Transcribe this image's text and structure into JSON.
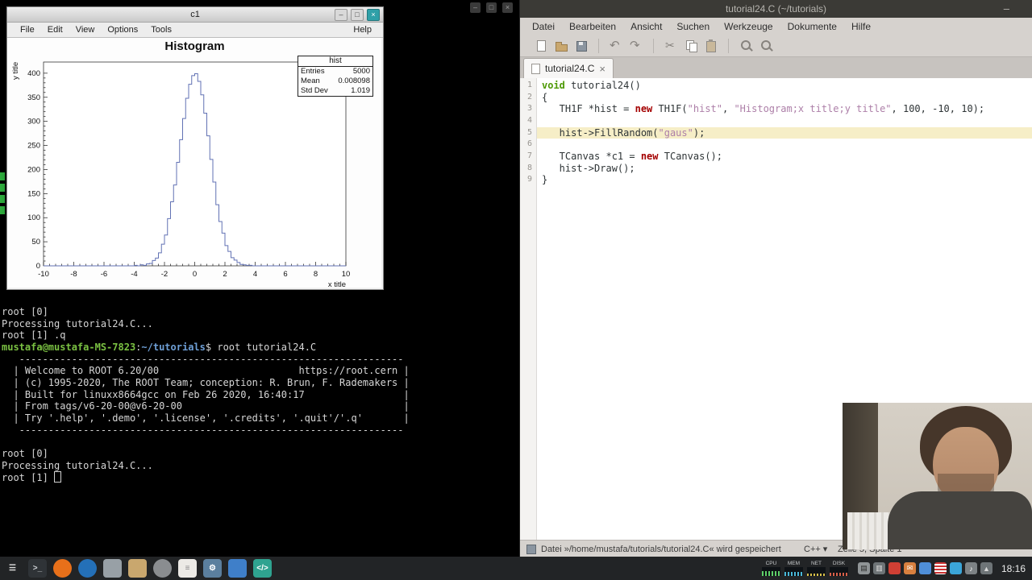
{
  "window_controls": {
    "minimize": "–",
    "maximize": "□",
    "close": "×"
  },
  "root_window": {
    "title": "c1",
    "menus": [
      "File",
      "Edit",
      "View",
      "Options",
      "Tools"
    ],
    "help_menu": "Help"
  },
  "chart_data": {
    "type": "bar",
    "style": "step-histogram",
    "title": "Histogram",
    "xlabel": "x title",
    "ylabel": "y title",
    "xlim": [
      -10,
      10
    ],
    "ylim": [
      0,
      400
    ],
    "x_ticks": [
      -10,
      -8,
      -6,
      -4,
      -2,
      0,
      2,
      4,
      6,
      8,
      10
    ],
    "y_ticks": [
      0,
      50,
      100,
      150,
      200,
      250,
      300,
      350,
      400
    ],
    "n_bins": 100,
    "bin_width": 0.2,
    "line_color": "#6272b4",
    "grid": false,
    "legend": false,
    "bin_centers": [
      -3.9,
      -3.7,
      -3.5,
      -3.3,
      -3.1,
      -2.9,
      -2.7,
      -2.5,
      -2.3,
      -2.1,
      -1.9,
      -1.7,
      -1.5,
      -1.3,
      -1.1,
      -0.9,
      -0.7,
      -0.5,
      -0.3,
      -0.1,
      0.1,
      0.3,
      0.5,
      0.7,
      0.9,
      1.1,
      1.3,
      1.5,
      1.7,
      1.9,
      2.1,
      2.3,
      2.5,
      2.7,
      2.9,
      3.1,
      3.3,
      3.5,
      3.7,
      3.9
    ],
    "counts": [
      1,
      0,
      2,
      1,
      4,
      5,
      11,
      16,
      27,
      45,
      64,
      98,
      133,
      168,
      215,
      262,
      306,
      348,
      377,
      395,
      399,
      383,
      355,
      317,
      270,
      221,
      174,
      127,
      92,
      68,
      42,
      30,
      17,
      12,
      7,
      3,
      2,
      1,
      1,
      0
    ],
    "stats": {
      "title": "hist",
      "rows": [
        [
          "Entries",
          "5000"
        ],
        [
          "Mean",
          "0.008098"
        ],
        [
          "Std Dev",
          "1.019"
        ]
      ]
    }
  },
  "terminal": {
    "lines": [
      [
        [
          "root [0]",
          "plain"
        ]
      ],
      [
        [
          "Processing tutorial24.C...",
          "plain"
        ]
      ],
      [
        [
          "root [1] .q",
          "plain"
        ]
      ],
      [
        [
          "mustafa@mustafa-MS-7823",
          "user"
        ],
        [
          ":",
          "plain"
        ],
        [
          "~/tutorials",
          "path"
        ],
        [
          "$ root tutorial24.C",
          "plain"
        ]
      ],
      [
        [
          "   ------------------------------------------------------------------",
          "plain"
        ]
      ],
      [
        [
          "  | Welcome to ROOT 6.20/00                        https://root.cern |",
          "plain"
        ]
      ],
      [
        [
          "  | (c) 1995-2020, The ROOT Team; conception: R. Brun, F. Rademakers |",
          "plain"
        ]
      ],
      [
        [
          "  | Built for linuxx8664gcc on Feb 26 2020, 16:40:17                 |",
          "plain"
        ]
      ],
      [
        [
          "  | From tags/v6-20-00@v6-20-00                                      |",
          "plain"
        ]
      ],
      [
        [
          "  | Try '.help', '.demo', '.license', '.credits', '.quit'/'.q'       |",
          "plain"
        ]
      ],
      [
        [
          "   ------------------------------------------------------------------",
          "plain"
        ]
      ],
      [
        [
          "",
          "plain"
        ]
      ],
      [
        [
          "root [0]",
          "plain"
        ]
      ],
      [
        [
          "Processing tutorial24.C...",
          "plain"
        ]
      ],
      [
        [
          "root [1] ",
          "plain"
        ],
        [
          "",
          "cursor"
        ]
      ]
    ]
  },
  "editor": {
    "titlebar_title": "tutorial24.C (~/tutorials)",
    "menus": [
      "Datei",
      "Bearbeiten",
      "Ansicht",
      "Suchen",
      "Werkzeuge",
      "Dokumente",
      "Hilfe"
    ],
    "toolbar": [
      "new",
      "open",
      "save",
      "|",
      "undo",
      "redo",
      "|",
      "cut",
      "copy",
      "paste",
      "|",
      "find",
      "replace"
    ],
    "tab": {
      "label": "tutorial24.C",
      "close": "×"
    },
    "code_lines": [
      {
        "n": "1",
        "current": false,
        "tokens": [
          [
            "void",
            "type"
          ],
          [
            " tutorial24()",
            "plain"
          ]
        ]
      },
      {
        "n": "2",
        "current": false,
        "tokens": [
          [
            "{",
            "plain"
          ]
        ]
      },
      {
        "n": "3",
        "current": false,
        "tokens": [
          [
            "   TH1F *hist = ",
            "plain"
          ],
          [
            "new",
            "kw"
          ],
          [
            " TH1F(",
            "plain"
          ],
          [
            "\"hist\"",
            "str"
          ],
          [
            ", ",
            "plain"
          ],
          [
            "\"Histogram;x title;y title\"",
            "str"
          ],
          [
            ", 100, -10, 10);",
            "plain"
          ]
        ]
      },
      {
        "n": "4",
        "current": false,
        "tokens": []
      },
      {
        "n": "5",
        "current": true,
        "tokens": [
          [
            "   hist->FillRandom(",
            "plain"
          ],
          [
            "\"gaus\"",
            "str"
          ],
          [
            ");",
            "plain"
          ]
        ]
      },
      {
        "n": "6",
        "current": false,
        "tokens": []
      },
      {
        "n": "7",
        "current": false,
        "tokens": [
          [
            "   TCanvas *c1 = ",
            "plain"
          ],
          [
            "new",
            "kw"
          ],
          [
            " TCanvas();",
            "plain"
          ]
        ]
      },
      {
        "n": "8",
        "current": false,
        "tokens": [
          [
            "   hist->Draw();",
            "plain"
          ]
        ]
      },
      {
        "n": "9",
        "current": false,
        "tokens": [
          [
            "}",
            "plain"
          ]
        ]
      }
    ],
    "statusbar": {
      "message": "Datei »/home/mustafa/tutorials/tutorial24.C« wird gespeichert",
      "language": "C++",
      "caret": "▾",
      "line_info": "Zeile 5, Spalte 1"
    }
  },
  "taskbar": {
    "apps": [
      {
        "name": "menu-button",
        "glyph": "☰",
        "bg": "none",
        "fg": "#dcdcdc",
        "shape": "square"
      },
      {
        "name": "terminal-launcher",
        "glyph": ">_",
        "bg": "#2f3337",
        "fg": "#cfd3d6",
        "shape": "square"
      },
      {
        "name": "firefox-launcher",
        "glyph": "",
        "bg": "#e8701a",
        "fg": "#ffffff",
        "shape": "circle"
      },
      {
        "name": "thunderbird-launcher",
        "glyph": "",
        "bg": "#2470b8",
        "fg": "#ffffff",
        "shape": "circle"
      },
      {
        "name": "app-launcher",
        "glyph": "",
        "bg": "#98a0a6",
        "fg": "#ffffff",
        "shape": "square"
      },
      {
        "name": "files-launcher",
        "glyph": "",
        "bg": "#c9a76e",
        "fg": "#ffffff",
        "shape": "square"
      },
      {
        "name": "gimp-launcher",
        "glyph": "",
        "bg": "#8a8d90",
        "fg": "#ffffff",
        "shape": "circle"
      },
      {
        "name": "text-editor-launcher",
        "glyph": "≡",
        "bg": "#eceae6",
        "fg": "#8a8a8a",
        "shape": "square"
      },
      {
        "name": "settings-launcher",
        "glyph": "⚙",
        "bg": "#5b7f9e",
        "fg": "#ffffff",
        "shape": "square"
      },
      {
        "name": "software-launcher",
        "glyph": "",
        "bg": "#3f7fc9",
        "fg": "#ffffff",
        "shape": "square"
      },
      {
        "name": "ide-launcher",
        "glyph": "</>",
        "bg": "#2fa390",
        "fg": "#ffffff",
        "shape": "square"
      }
    ],
    "monitors": [
      {
        "label": "CPU",
        "color": "#5fd068",
        "fill": 0.55
      },
      {
        "label": "MEM",
        "color": "#49b8d8",
        "fill": 0.45
      },
      {
        "label": "NET",
        "color": "#d8c049",
        "fill": 0.3
      },
      {
        "label": "DISK",
        "color": "#d86049",
        "fill": 0.35
      }
    ],
    "tray": [
      {
        "name": "clipboard-indicator",
        "glyph": "▤",
        "bg": "#8f9496",
        "fg": "#2a2a2a"
      },
      {
        "name": "keyboard-layout-indicator",
        "glyph": "▥",
        "bg": "#6e7477",
        "fg": "#e0e0e0"
      },
      {
        "name": "notification-indicator",
        "glyph": "",
        "bg": "#cf3f34",
        "fg": "#ffffff"
      },
      {
        "name": "mail-indicator",
        "glyph": "✉",
        "bg": "#d8803f",
        "fg": "#ffffff"
      },
      {
        "name": "chat-indicator",
        "glyph": "",
        "bg": "#4f8fd9",
        "fg": "#ffffff"
      },
      {
        "name": "flag-indicator",
        "glyph": "",
        "bg": "flag",
        "fg": ""
      },
      {
        "name": "security-indicator",
        "glyph": "",
        "bg": "#3ba5d8",
        "fg": "#ffffff"
      },
      {
        "name": "volume-indicator",
        "glyph": "♪",
        "bg": "#7d8285",
        "fg": "#ffffff"
      },
      {
        "name": "network-indicator",
        "glyph": "▲",
        "bg": "#6e7477",
        "fg": "#d8d8d8"
      }
    ],
    "clock": "18:16"
  }
}
